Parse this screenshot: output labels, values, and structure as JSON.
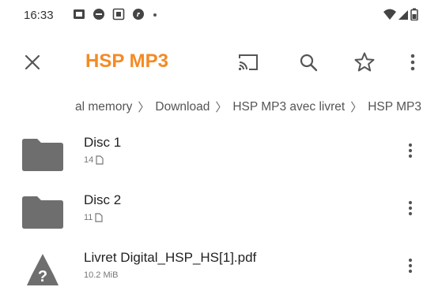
{
  "status_bar": {
    "time": "16:33"
  },
  "app_bar": {
    "title": "HSP MP3",
    "accent_color": "#f58a24",
    "icons": [
      "close-icon",
      "cast-icon",
      "search-icon",
      "star-outline-icon",
      "more-vert-icon"
    ]
  },
  "breadcrumb": {
    "items": [
      "al memory",
      "Download",
      "HSP MP3 avec livret",
      "HSP MP3"
    ]
  },
  "files": [
    {
      "name": "Disc 1",
      "meta": "14",
      "icon": "folder-icon"
    },
    {
      "name": "Disc 2",
      "meta": "11",
      "icon": "folder-icon"
    },
    {
      "name": "Livret Digital_HSP_HS[1].pdf",
      "meta": "10.2 MiB",
      "icon": "unknown-file-icon"
    }
  ]
}
